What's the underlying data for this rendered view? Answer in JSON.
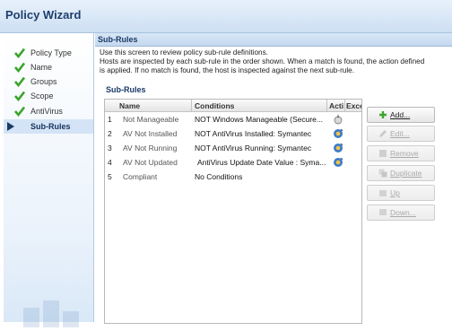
{
  "window": {
    "title": "Policy Wizard"
  },
  "sidebar": {
    "items": [
      {
        "label": "Policy Type",
        "done": true
      },
      {
        "label": "Name",
        "done": true
      },
      {
        "label": "Groups",
        "done": true
      },
      {
        "label": "Scope",
        "done": true
      },
      {
        "label": "AntiVirus",
        "done": true
      },
      {
        "label": "Sub-Rules",
        "active": true
      }
    ]
  },
  "panel": {
    "header": "Sub-Rules",
    "description_line1": "Use this screen to review policy sub-rule definitions.",
    "description_line2": "Hosts are inspected by each sub-rule in the order shown. When a match is found, the action defined",
    "description_line3": "is applied. If no match is found, the host is inspected against the next sub-rule.",
    "subrules_title": "Sub-Rules"
  },
  "table": {
    "columns": [
      "Name",
      "Conditions",
      "Action",
      "Exce"
    ],
    "rows": [
      {
        "num": "1",
        "name": "Not Manageable",
        "condition": "NOT  Windows Manageable (Secure...",
        "icon": "notify-icon"
      },
      {
        "num": "2",
        "name": "AV Not Installed",
        "condition": "NOT  AntiVirus Installed: Symantec",
        "icon": "action-icon"
      },
      {
        "num": "3",
        "name": "AV Not Running",
        "condition": "NOT  AntiVirus Running: Symantec",
        "icon": "action-icon"
      },
      {
        "num": "4",
        "name": "AV Not Updated",
        "condition": "AntiVirus Update Date Value : Syma...",
        "icon": "action-icon"
      },
      {
        "num": "5",
        "name": "Compliant",
        "condition": "No Conditions",
        "icon": ""
      }
    ]
  },
  "buttons": {
    "add": "Add...",
    "edit": "Edit...",
    "remove": "Remove",
    "duplicate": "Duplicate",
    "up": "Up",
    "down": "Down..."
  },
  "colors": {
    "check": "#3aa52c",
    "accent": "#1b3a66"
  }
}
